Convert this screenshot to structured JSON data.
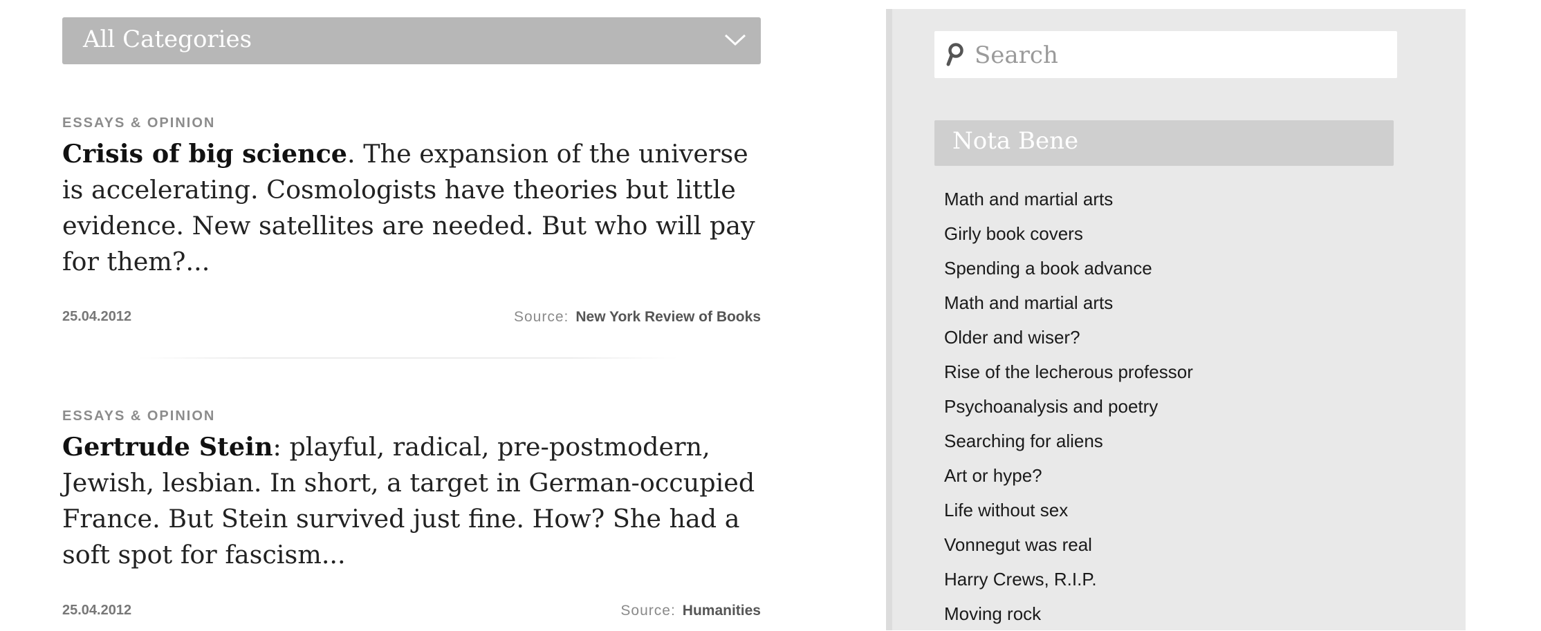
{
  "category_select": {
    "selected": "All Categories"
  },
  "articles": [
    {
      "category": "ESSAYS & OPINION",
      "headline": "Crisis of big science",
      "teaser": ". The expansion of the universe is accelerating. Cosmologists have theories but little evidence. New satellites are needed. But who will pay for them?...",
      "date": "25.04.2012",
      "source_label": "Source:",
      "source_name": "New York Review of Books"
    },
    {
      "category": "ESSAYS & OPINION",
      "headline": "Gertrude Stein",
      "teaser": ": playful, radical, pre-postmodern, Jewish, lesbian. In short, a target in German-occupied France. But Stein survived just fine. How? She had a soft spot for fascism...",
      "date": "25.04.2012",
      "source_label": "Source:",
      "source_name": "Humanities"
    }
  ],
  "sidebar": {
    "search": {
      "placeholder": "Search",
      "icon": "search-icon"
    },
    "nota_bene": {
      "title": "Nota Bene",
      "items": [
        "Math and martial arts",
        "Girly book covers",
        "Spending a book advance",
        "Math and martial arts",
        "Older and wiser?",
        "Rise of the lecherous professor",
        "Psychoanalysis and poetry",
        "Searching for aliens",
        "Art or hype?",
        "Life without sex",
        "Vonnegut was real",
        "Harry Crews, R.I.P.",
        "Moving rock"
      ]
    }
  },
  "colors": {
    "select_bg": "#b7b7b7",
    "sidebar_bg": "#e9e9e9",
    "nota_bene_header_bg": "#cfcfcf"
  }
}
